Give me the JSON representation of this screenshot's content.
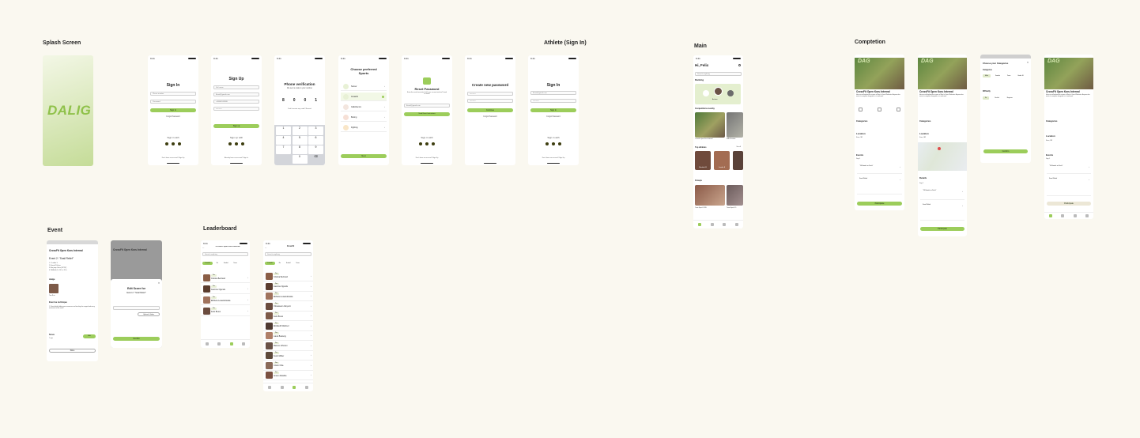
{
  "sections": {
    "splash": "Splash Screen",
    "athlete": "Athlete (Sign In)",
    "main": "Main",
    "competition": "Comptetion",
    "event": "Event",
    "leaderboard": "Leaderboard"
  },
  "status_time": "9:41",
  "splash": {
    "logo": "DALIG"
  },
  "signin": {
    "title": "Sign In",
    "email_ph": "Phone number",
    "password_ph": "Password",
    "btn": "Sign In",
    "forgot": "Forgot Password",
    "with": "Sign in with",
    "footer": "Don't have an account? Sign Up"
  },
  "signup": {
    "title": "Sign Up",
    "name": "Full name",
    "email": "Email@gmail.com",
    "phone": "+48664532888",
    "password": "••••••••••",
    "btn": "Sign up",
    "with": "Sign up with",
    "footer": "Already have an account? Sign In"
  },
  "phone": {
    "title": "Phone verification",
    "desc": "We sent a code to your number",
    "code": [
      "8",
      "0",
      "0",
      "1"
    ],
    "resend": "Didn't receive any code? Resend",
    "keys": [
      "1",
      "2",
      "3",
      "4",
      "5",
      "6",
      "7",
      "8",
      "9",
      "",
      "0",
      "⌫"
    ]
  },
  "sports": {
    "title": "Choose preferred Sports",
    "items": [
      "Soccer",
      "CrossFit",
      "Calisthenics",
      "Boxing",
      "Fighting"
    ],
    "btn": "Next"
  },
  "reset": {
    "title": "Reset Password",
    "desc": "Enter the email associated with your account and we'll send an email",
    "field": "Email@gmail.com",
    "btn": "Send Reset Instructions",
    "with": "Sign in with",
    "footer": "Don't have an account? Sign Up"
  },
  "newpass": {
    "title": "Create new password",
    "p1": "••••••••••",
    "p2": "••••••••••",
    "btn": "Continue",
    "forgot": "Forgot Password"
  },
  "signin2": {
    "title": "Sign In",
    "email": "Email@gmail.com",
    "password": "••••••••••",
    "btn": "Sign In",
    "forgot": "Forgot Password",
    "with": "Sign in with",
    "footer": "Don't have an account? Sign Up"
  },
  "main": {
    "greet": "Hi, Felix",
    "search": "Search anything",
    "ranking": "Ranking",
    "rank_name": "Actions",
    "comp_nearby": "Competitions nearby",
    "comp1": "CrossFit Open Koru Internal",
    "comp2": "FitBol Invitatio",
    "top": "Top athletes",
    "a1": "Elizabeth M",
    "a2": "Jennifer B",
    "groups": "Groups",
    "g1": "Team Sport KORU",
    "g2": "Team Sport KO",
    "see_all": "See all"
  },
  "comp": {
    "title": "CrossFit Open Koru Internal",
    "desc": "Here we will upload the scores of Koru's Open Workouts. Anyone who wants to compete alongside us is welcome.",
    "categories": "Categories",
    "location": "Location",
    "location_val": "Koru, SR",
    "events": "Events",
    "day": "Day 1",
    "ev1": "\"10 Hands or Deck\"",
    "ev2": "Snail Relief",
    "details": "Details",
    "btn": "Participate",
    "choose": "Choose your Categories",
    "cat_opts": [
      "Male",
      "Female",
      "Team",
      "Under 30"
    ],
    "difficulty": "Difficulty",
    "diff_opts": [
      "Rx",
      "Scaled",
      "Beginner"
    ],
    "confirm": "Confirm"
  },
  "event": {
    "title": "CrossFit Open Koru Internal",
    "ev": "Event 2: \"Snail Relief\"",
    "lines": [
      "1. 1 Ladder 3",
      "2. Burned Pull ups",
      "3. Box jump Overs (20\"/24\")",
      "4. Wallballs (3 x 14# or 20#)"
    ],
    "judge": "Judge",
    "judge_name": "Tom Ruiz",
    "technique": "Exercise technique",
    "tech_text": "1. Stand while holding your resources and tracking the ranged and every movement of the event.",
    "score": "Score",
    "score_val": "7 reps",
    "edit": "Edit",
    "done": "Done",
    "edit_title": "Edit Score for",
    "edit_ev": "Event 2: \"Snail Relief\"",
    "upload": "Upload a Video",
    "confirm": "Confirm"
  },
  "leader": {
    "title": "CrossFit Open Koru Internal",
    "search": "Search anything",
    "tabs": [
      "CrossFit",
      "Rx",
      "Scaled",
      "Team",
      "Beginner"
    ],
    "rows": [
      "Cristina Bertrand",
      "Jasmine Ogundu",
      "Elzbieta Lewandowska",
      "Felix Bruno"
    ],
    "rows2": [
      "Cristina Bertrand",
      "Jasmine Ogundu",
      "Elzbieta Lewandowska",
      "Oluwaseun Adeyemi",
      "Felix Bruno",
      "Elizabeth Martinez",
      "Laura Boateng",
      "Marcus Johnson",
      "Kevin Müller",
      "Cristin Chia",
      "Anson Zeballos"
    ],
    "rank_pill": "Pos"
  },
  "colors": {
    "accent": "#9ccd5b",
    "bg": "#faf8f0",
    "dark": "#3e3e10"
  }
}
